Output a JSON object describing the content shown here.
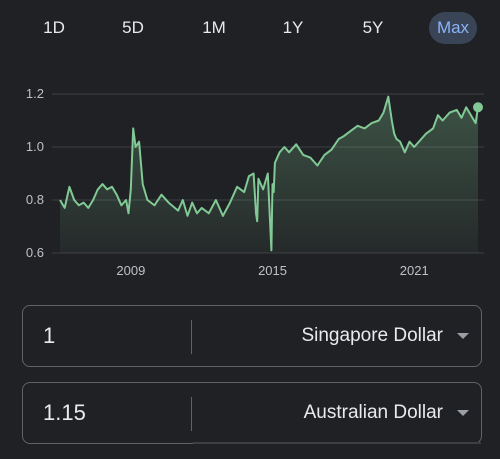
{
  "range_tabs": [
    {
      "label": "1D",
      "active": false
    },
    {
      "label": "5D",
      "active": false
    },
    {
      "label": "1M",
      "active": false
    },
    {
      "label": "1Y",
      "active": false
    },
    {
      "label": "5Y",
      "active": false
    },
    {
      "label": "Max",
      "active": true
    }
  ],
  "converter": {
    "from": {
      "amount": "1",
      "currency": "Singapore Dollar"
    },
    "to": {
      "amount": "1.15",
      "currency": "Australian Dollar"
    }
  },
  "colors": {
    "line": "#81c995",
    "accent": "#8ab4f8",
    "background": "#202124"
  },
  "chart_data": {
    "type": "line",
    "title": "",
    "xlabel": "",
    "ylabel": "",
    "x_tick_labels": [
      "2009",
      "2015",
      "2021"
    ],
    "y_tick_labels": [
      "0.6",
      "0.8",
      "1.0",
      "1.2"
    ],
    "ylim": [
      0.6,
      1.2
    ],
    "xlim": [
      2006,
      2023.7
    ],
    "grid": true,
    "fill_below_line": true,
    "current_value_marker": true,
    "series": [
      {
        "x": [
          2006.0,
          2006.2,
          2006.4,
          2006.6,
          2006.8,
          2007.0,
          2007.2,
          2007.4,
          2007.6,
          2007.8,
          2008.0,
          2008.2,
          2008.4,
          2008.6,
          2008.8,
          2008.9,
          2009.0,
          2009.1,
          2009.2,
          2009.35,
          2009.5,
          2009.7,
          2010.0,
          2010.3,
          2010.6,
          2011.0,
          2011.2,
          2011.4,
          2011.6,
          2011.8,
          2012.0,
          2012.3,
          2012.6,
          2012.9,
          2013.2,
          2013.5,
          2013.8,
          2014.0,
          2014.2,
          2014.3,
          2014.35,
          2014.4,
          2014.6,
          2014.8,
          2014.95,
          2015.0,
          2015.05,
          2015.1,
          2015.3,
          2015.5,
          2015.7,
          2016.0,
          2016.3,
          2016.6,
          2016.9,
          2017.2,
          2017.5,
          2017.8,
          2018.0,
          2018.3,
          2018.6,
          2018.9,
          2019.2,
          2019.5,
          2019.7,
          2019.9,
          2020.05,
          2020.15,
          2020.25,
          2020.4,
          2020.6,
          2020.8,
          2021.0,
          2021.3,
          2021.5,
          2021.8,
          2022.0,
          2022.2,
          2022.5,
          2022.8,
          2023.0,
          2023.2,
          2023.4,
          2023.6,
          2023.7
        ],
        "y": [
          0.8,
          0.77,
          0.85,
          0.8,
          0.78,
          0.79,
          0.77,
          0.8,
          0.84,
          0.86,
          0.84,
          0.85,
          0.82,
          0.78,
          0.8,
          0.75,
          0.84,
          1.07,
          1.0,
          1.02,
          0.86,
          0.8,
          0.78,
          0.82,
          0.79,
          0.76,
          0.8,
          0.74,
          0.79,
          0.75,
          0.77,
          0.75,
          0.8,
          0.74,
          0.79,
          0.85,
          0.83,
          0.89,
          0.9,
          0.75,
          0.72,
          0.88,
          0.84,
          0.9,
          0.61,
          0.86,
          0.83,
          0.94,
          0.98,
          1.0,
          0.98,
          1.01,
          0.97,
          0.96,
          0.93,
          0.97,
          0.99,
          1.03,
          1.04,
          1.06,
          1.08,
          1.07,
          1.09,
          1.1,
          1.13,
          1.19,
          1.1,
          1.05,
          1.03,
          1.02,
          0.98,
          1.02,
          1.0,
          1.03,
          1.05,
          1.07,
          1.12,
          1.1,
          1.13,
          1.14,
          1.11,
          1.15,
          1.12,
          1.09,
          1.15
        ]
      }
    ]
  }
}
